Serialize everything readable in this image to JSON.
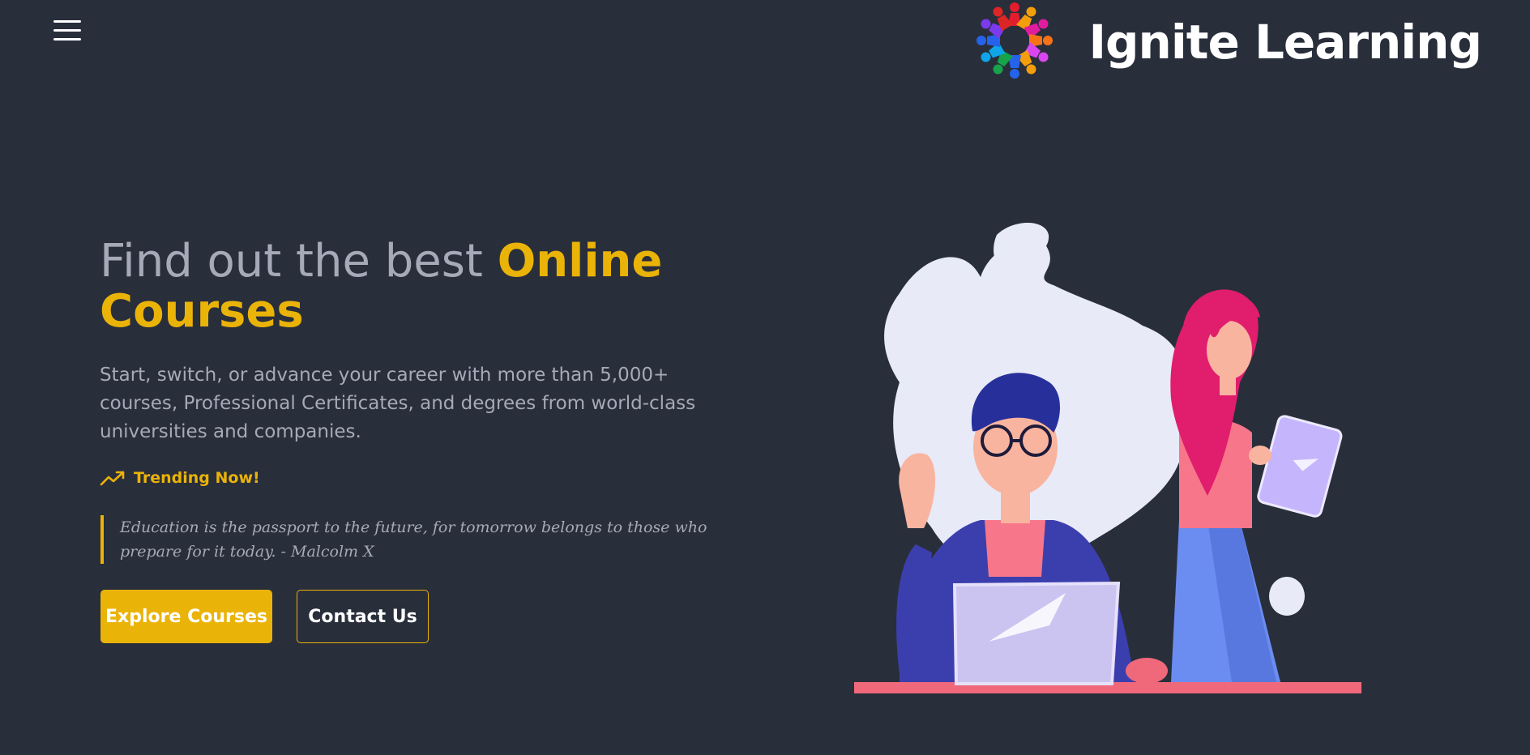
{
  "header": {
    "brand_name": "Ignite Learning",
    "menu_icon": "hamburger-menu-icon",
    "logo_icon": "people-circle-logo"
  },
  "hero": {
    "title_part1": "Find out the best ",
    "title_accent": "Online Courses",
    "subtitle": "Start, switch, or advance your career with more than 5,000+ courses, Professional Certificates, and degrees from world-class universities and companies.",
    "trending_label": "Trending Now!",
    "trending_icon": "trending-up-icon",
    "quote": "Education is the passport to the future, for tomorrow belongs to those who prepare for it today. - Malcolm X",
    "primary_button": "Explore Courses",
    "secondary_button": "Contact Us",
    "illustration": "students-with-laptop-and-tablet"
  },
  "colors": {
    "background": "#292e3b",
    "accent": "#eab308",
    "muted_text": "#a6aab8",
    "white": "#ffffff"
  }
}
